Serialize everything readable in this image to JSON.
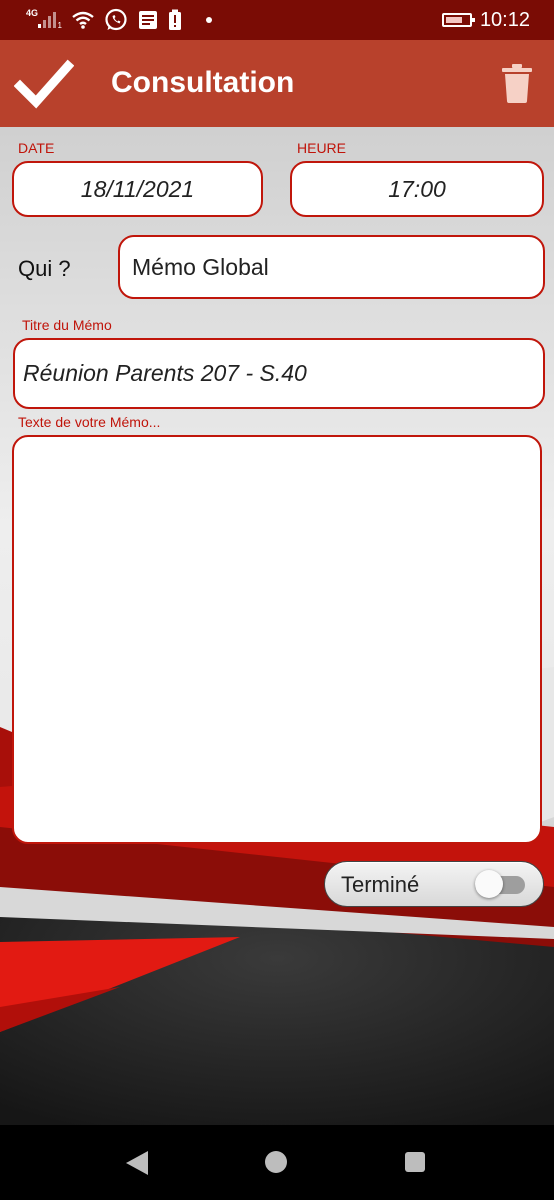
{
  "status_bar": {
    "network_type": "4G",
    "sim_slot": "1",
    "time": "10:12",
    "icons": [
      "signal-icon",
      "wifi-icon",
      "whatsapp-icon",
      "message-icon",
      "alert-icon",
      "dot-icon",
      "battery-icon"
    ]
  },
  "app_bar": {
    "title": "Consultation",
    "confirm_icon": "check-icon",
    "delete_icon": "trash-icon"
  },
  "form": {
    "date": {
      "label": "DATE",
      "value": "18/11/2021"
    },
    "heure": {
      "label": "HEURE",
      "value": "17:00"
    },
    "qui": {
      "label": "Qui ?",
      "value": "Mémo Global"
    },
    "titre": {
      "label": "Titre du Mémo",
      "value": "Réunion Parents 207 - S.40"
    },
    "texte": {
      "label": "Texte de votre Mémo...",
      "value": ""
    },
    "termine": {
      "label": "Terminé",
      "checked": false
    }
  },
  "nav_bar": {
    "icons": [
      "back-icon",
      "home-icon",
      "recents-icon"
    ]
  },
  "colors": {
    "status_bar": "#7a0c05",
    "app_bar": "#b8412c",
    "field_border": "#c0160b",
    "label": "#c0140a"
  }
}
